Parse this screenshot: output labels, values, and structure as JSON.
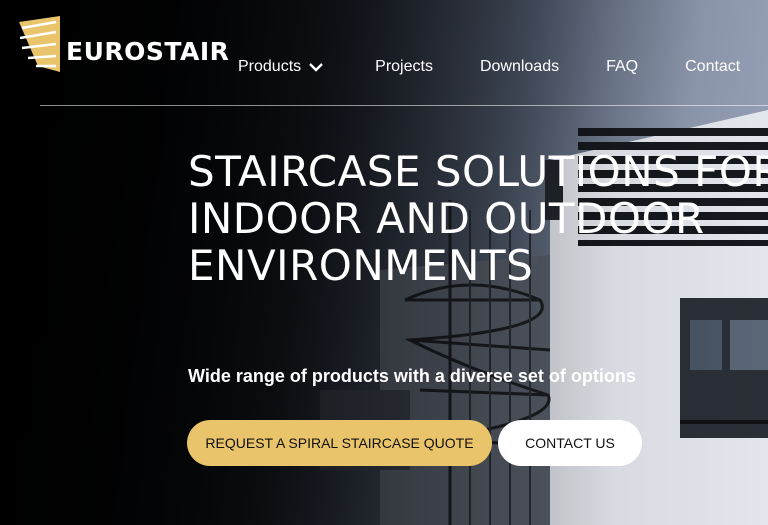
{
  "brand": {
    "name": "EUROSTAIR",
    "logo_icon": "eurostair-fan-logo",
    "accent": "#e9c46a"
  },
  "nav": {
    "items": [
      {
        "label": "Products",
        "has_dropdown": true
      },
      {
        "label": "Projects"
      },
      {
        "label": "Downloads"
      },
      {
        "label": "FAQ"
      },
      {
        "label": "Contact"
      }
    ],
    "dropdown_icon": "chevron-down-icon"
  },
  "hero": {
    "headline_lines": [
      "STAIRCASE SOLUTIONS FOR",
      "INDOOR AND OUTDOOR",
      "ENVIRONMENTS"
    ],
    "subheadline": "Wide range of products with a diverse set of options",
    "primary_cta": "REQUEST A SPIRAL STAIRCASE QUOTE",
    "secondary_cta": "CONTACT US",
    "primary_cta_color": "#e9c46a",
    "secondary_cta_color": "#ffffff"
  }
}
